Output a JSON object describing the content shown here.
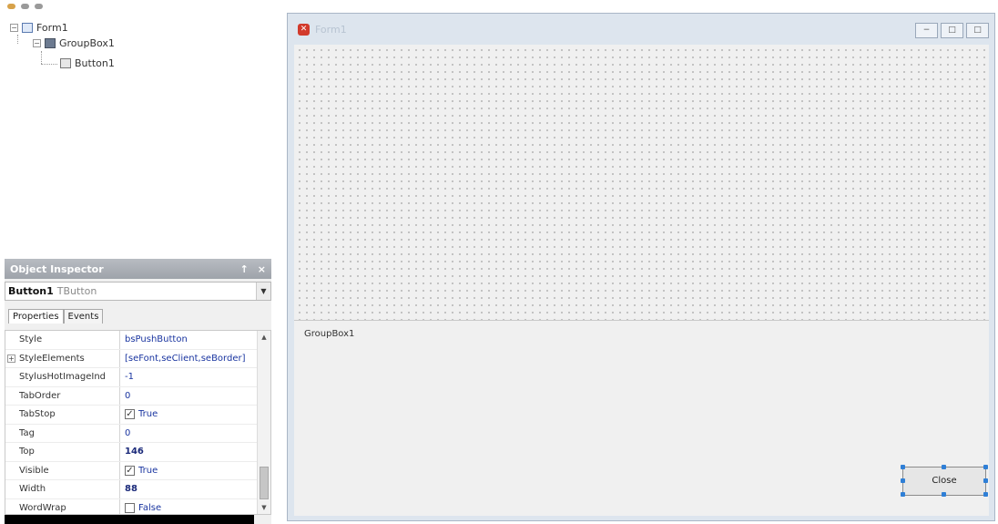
{
  "tree": {
    "nodes": [
      {
        "label": "Form1",
        "icon": "form-icon"
      },
      {
        "label": "GroupBox1",
        "icon": "groupbox-icon"
      },
      {
        "label": "Button1",
        "icon": "button-icon"
      }
    ]
  },
  "inspector": {
    "title": "Object Inspector",
    "pin_glyph": "↑",
    "close_glyph": "×",
    "component_name": "Button1",
    "component_type": "TButton",
    "tabs": [
      "Properties",
      "Events"
    ],
    "properties": [
      {
        "name": "Style",
        "value": "bsPushButton",
        "expandable": false,
        "checkbox": false,
        "changed": false
      },
      {
        "name": "StyleElements",
        "value": "[seFont,seClient,seBorder]",
        "expandable": true,
        "checkbox": false,
        "changed": false
      },
      {
        "name": "StylusHotImageInd",
        "value": "-1",
        "expandable": false,
        "checkbox": false,
        "changed": false
      },
      {
        "name": "TabOrder",
        "value": "0",
        "expandable": false,
        "checkbox": false,
        "changed": false
      },
      {
        "name": "TabStop",
        "value": "True",
        "expandable": false,
        "checkbox": true,
        "checked": true,
        "changed": false
      },
      {
        "name": "Tag",
        "value": "0",
        "expandable": false,
        "checkbox": false,
        "changed": false
      },
      {
        "name": "Top",
        "value": "146",
        "expandable": false,
        "checkbox": false,
        "changed": true
      },
      {
        "name": "Visible",
        "value": "True",
        "expandable": false,
        "checkbox": true,
        "checked": true,
        "changed": false
      },
      {
        "name": "Width",
        "value": "88",
        "expandable": false,
        "checkbox": false,
        "changed": true
      },
      {
        "name": "WordWrap",
        "value": "False",
        "expandable": false,
        "checkbox": true,
        "checked": false,
        "changed": false
      }
    ]
  },
  "form": {
    "title": "Form1",
    "window_buttons": [
      "−",
      "□",
      "□"
    ],
    "groupbox_caption": "GroupBox1",
    "button_caption": "Close"
  },
  "colors": {
    "accent_blue": "#2f7fd6",
    "app_icon_red": "#d23a2b",
    "property_value_blue": "#1a35a0"
  }
}
